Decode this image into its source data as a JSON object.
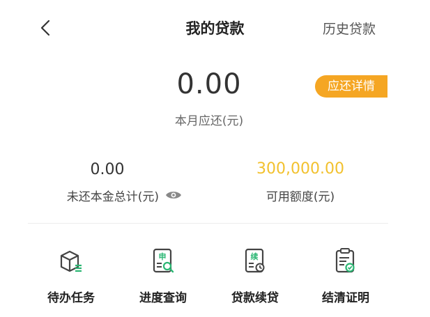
{
  "header": {
    "title": "我的贷款",
    "history_label": "历史贷款"
  },
  "due": {
    "amount": "0.00",
    "label": "本月应还(元)",
    "detail_button": "应还详情"
  },
  "summary": {
    "principal_value": "0.00",
    "principal_label": "未还本金总计(元)",
    "credit_value": "300,000.00",
    "credit_label": "可用额度(元)"
  },
  "actions": [
    {
      "label": "待办任务",
      "icon": "todo-box-icon"
    },
    {
      "label": "进度查询",
      "icon": "progress-query-icon",
      "icon_text": "申"
    },
    {
      "label": "贷款续贷",
      "icon": "renew-loan-icon",
      "icon_text": "续"
    },
    {
      "label": "结清证明",
      "icon": "settlement-certificate-icon"
    }
  ],
  "colors": {
    "accent_orange": "#f5a623",
    "credit_yellow": "#f2c12e",
    "icon_green": "#2bb673"
  }
}
